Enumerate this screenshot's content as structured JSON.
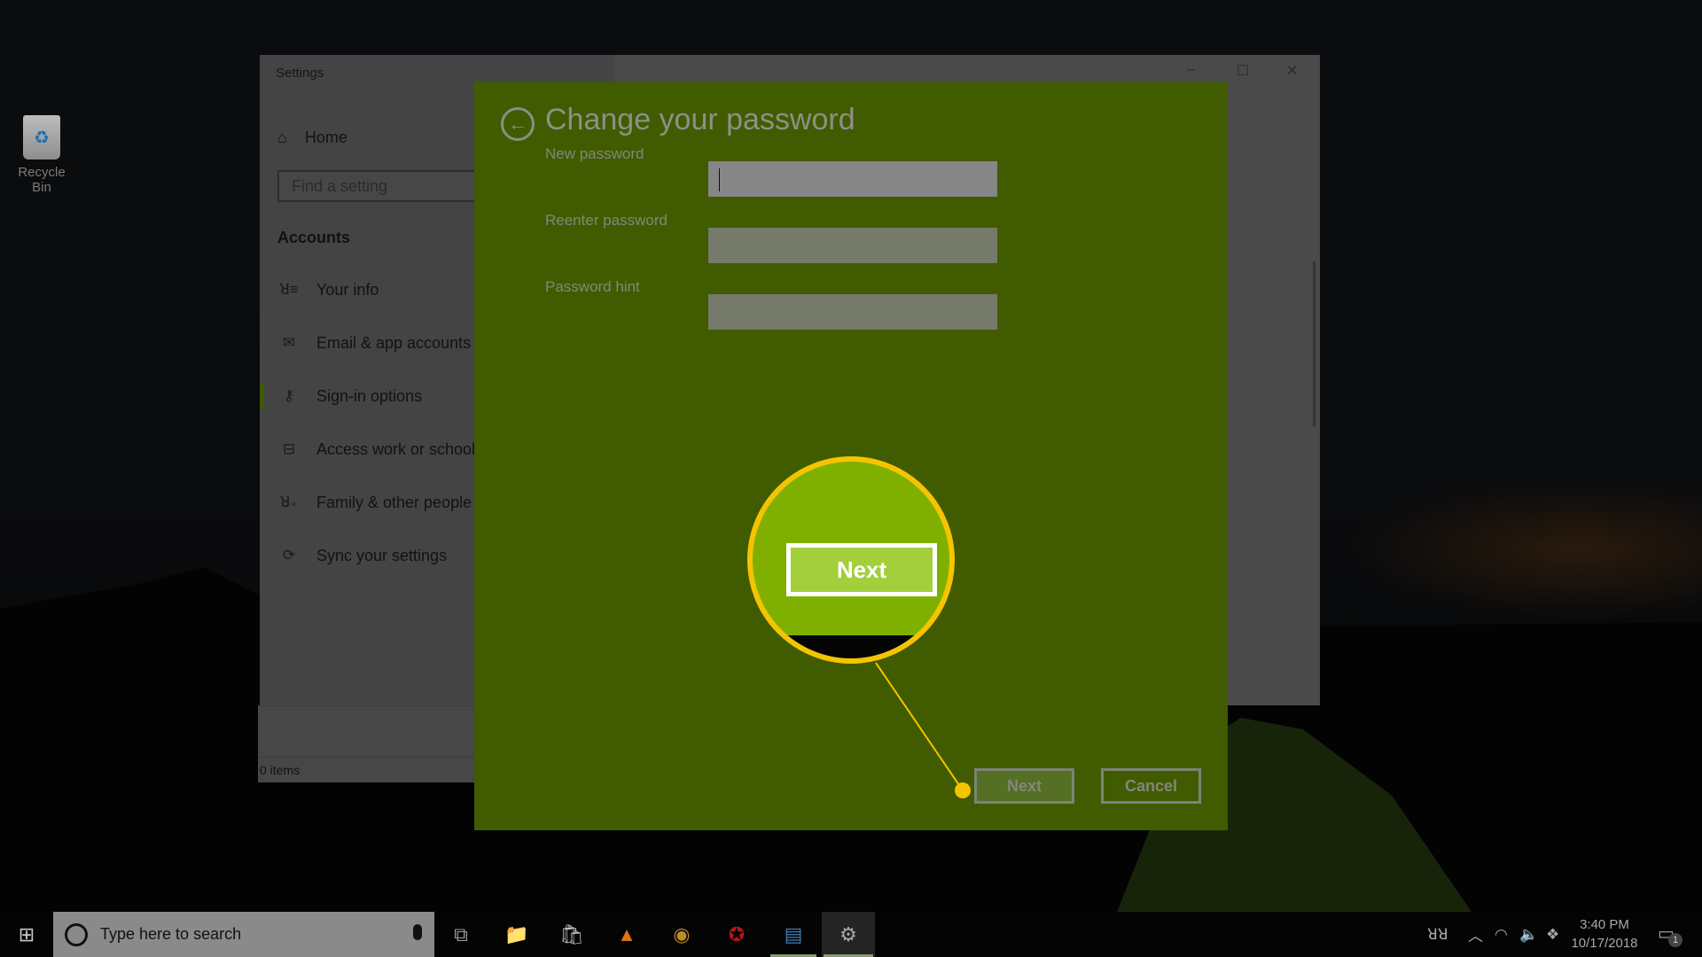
{
  "desktop": {
    "icons": [
      {
        "label": "Recycle Bin",
        "icon": "recycle-bin-icon"
      }
    ]
  },
  "background_window": {
    "status": "0 items"
  },
  "settings": {
    "title": "Settings",
    "home_label": "Home",
    "search_placeholder": "Find a setting",
    "section": "Accounts",
    "nav": [
      {
        "label": "Your info",
        "icon": "person-list-icon"
      },
      {
        "label": "Email & app accounts",
        "icon": "mail-icon"
      },
      {
        "label": "Sign-in options",
        "icon": "key-icon",
        "active": true
      },
      {
        "label": "Access work or school",
        "icon": "briefcase-icon"
      },
      {
        "label": "Family & other people",
        "icon": "person-add-icon"
      },
      {
        "label": "Sync your settings",
        "icon": "sync-icon"
      }
    ],
    "window_controls": {
      "minimize": "–",
      "maximize": "☐",
      "close": "✕"
    }
  },
  "dialog": {
    "title": "Change your password",
    "back_icon": "←",
    "fields": [
      {
        "label": "New password",
        "value": "",
        "focused": true
      },
      {
        "label": "Reenter password",
        "value": ""
      },
      {
        "label": "Password hint",
        "value": ""
      }
    ],
    "next_label": "Next",
    "cancel_label": "Cancel",
    "accent": "#415b00"
  },
  "callout": {
    "zoomed_label": "Next",
    "highlight_color": "#f5c400"
  },
  "taskbar": {
    "search_placeholder": "Type here to search",
    "apps": [
      {
        "name": "task-view",
        "glyph": "⧉"
      },
      {
        "name": "file-explorer",
        "glyph": "📁"
      },
      {
        "name": "microsoft-store",
        "glyph": "🛍"
      },
      {
        "name": "vlc",
        "glyph": "▲"
      },
      {
        "name": "chrome",
        "glyph": "◉"
      },
      {
        "name": "app-red",
        "glyph": "✪"
      },
      {
        "name": "control-panel",
        "glyph": "▤"
      },
      {
        "name": "settings",
        "glyph": "⚙"
      }
    ],
    "time": "3:40 PM",
    "date": "10/17/2018",
    "notification_count": "1"
  }
}
